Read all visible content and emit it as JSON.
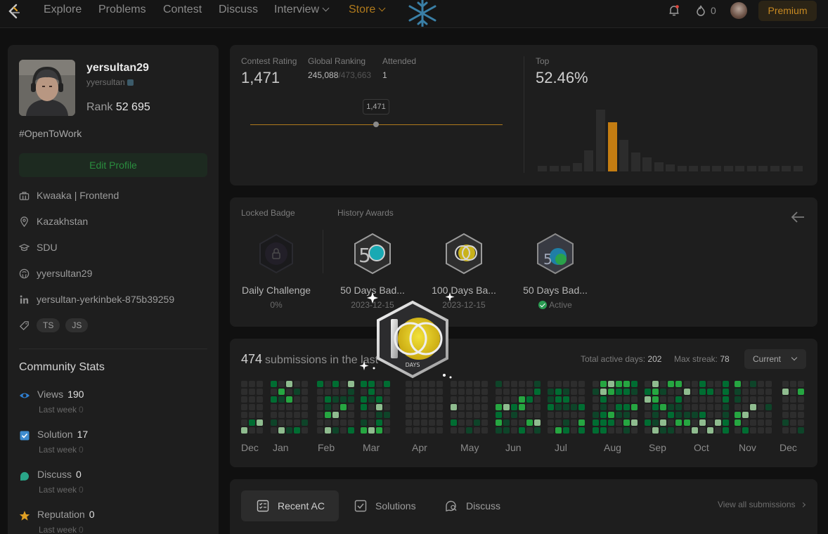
{
  "nav": {
    "items": [
      "Explore",
      "Problems",
      "Contest",
      "Discuss",
      "Interview",
      "Store"
    ],
    "streak": "0",
    "premium": "Premium"
  },
  "profile": {
    "display_name": "yersultan29",
    "handle": "yyersultan",
    "rank_label": "Rank",
    "rank_value": "52 695",
    "bio": "#OpenToWork",
    "edit_button": "Edit Profile",
    "company": "Kwaaka | Frontend",
    "location": "Kazakhstan",
    "school": "SDU",
    "github": "yyersultan29",
    "linkedin": "yersultan-yerkinbek-875b39259",
    "skills": [
      "TS",
      "JS"
    ]
  },
  "community_stats": {
    "title": "Community Stats",
    "items": [
      {
        "label": "Views",
        "value": "190",
        "last_week_label": "Last week",
        "last_week": "0",
        "color": "#2f7fd1"
      },
      {
        "label": "Solution",
        "value": "17",
        "last_week_label": "Last week",
        "last_week": "0",
        "color": "#3e8ccf"
      },
      {
        "label": "Discuss",
        "value": "0",
        "last_week_label": "Last week",
        "last_week": "0",
        "color": "#2aa588"
      },
      {
        "label": "Reputation",
        "value": "0",
        "last_week_label": "Last week",
        "last_week": "0",
        "color": "#e0a024"
      }
    ]
  },
  "contest": {
    "rating_label": "Contest Rating",
    "rating": "1,471",
    "global_label": "Global Ranking",
    "global_rank": "245,088",
    "global_total": "/473,663",
    "attended_label": "Attended",
    "attended": "1",
    "tooltip": "1,471",
    "top_label": "Top",
    "top_value": "52.46%"
  },
  "badges": {
    "locked_label": "Locked Badge",
    "history_label": "History Awards",
    "items": [
      {
        "name": "Daily Challenge",
        "sub": "0%"
      },
      {
        "name": "50 Days Bad...",
        "sub": "2023-12-15"
      },
      {
        "name": "100 Days Ba...",
        "sub": "2023-12-15"
      },
      {
        "name": "50 Days Bad...",
        "sub": "Active"
      }
    ]
  },
  "submissions": {
    "count": "474",
    "title_text": "submissions in the last",
    "active_days_label": "Total active days:",
    "active_days": "202",
    "max_streak_label": "Max streak:",
    "max_streak": "78",
    "dropdown": "Current",
    "months": [
      "Dec",
      "Jan",
      "Feb",
      "Mar",
      "Apr",
      "May",
      "Jun",
      "Jul",
      "Aug",
      "Sep",
      "Oct",
      "Nov",
      "Dec"
    ]
  },
  "recent": {
    "tabs": [
      "Recent AC",
      "Solutions",
      "Discuss"
    ],
    "view_all": "View all submissions"
  },
  "overlay_badge_text": "DAYS",
  "colors": {
    "accent": "#b07a1c",
    "green": "#2a8c3e",
    "bg": "#101010",
    "card": "#1e1e1e"
  }
}
